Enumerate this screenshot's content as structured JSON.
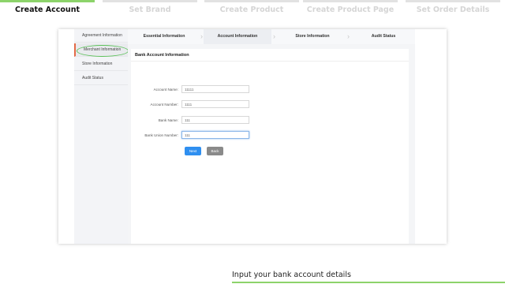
{
  "steps": [
    {
      "label": "Create Account",
      "active": true
    },
    {
      "label": "Set Brand",
      "active": false
    },
    {
      "label": "Create Product",
      "active": false
    },
    {
      "label": "Create Product Page",
      "active": false
    },
    {
      "label": "Set Order Details",
      "active": false
    }
  ],
  "sidebar": {
    "items": [
      {
        "label": "Agreement Information"
      },
      {
        "label": "Merchant Information",
        "active": true
      },
      {
        "label": "Store Information"
      },
      {
        "label": "Audit Status"
      }
    ]
  },
  "tabs": [
    {
      "label": "Essential Information"
    },
    {
      "label": "Account Information",
      "active": true
    },
    {
      "label": "Store Information"
    },
    {
      "label": "Audit Status"
    }
  ],
  "form": {
    "title": "Bank Account Information",
    "fields": [
      {
        "label": "Account Name:",
        "value": "11111"
      },
      {
        "label": "Account Number:",
        "value": "1111"
      },
      {
        "label": "Bank Name:",
        "value": "111"
      },
      {
        "label": "Bank Union Number:",
        "value": "111",
        "focused": true
      }
    ],
    "next_label": "Next",
    "back_label": "Back"
  },
  "caption": "Input your bank account details",
  "colors": {
    "accent_green": "#8cd36a",
    "highlight_circle": "#5cc15a",
    "primary_blue": "#2f8ff0",
    "active_marker": "#e36a46"
  }
}
